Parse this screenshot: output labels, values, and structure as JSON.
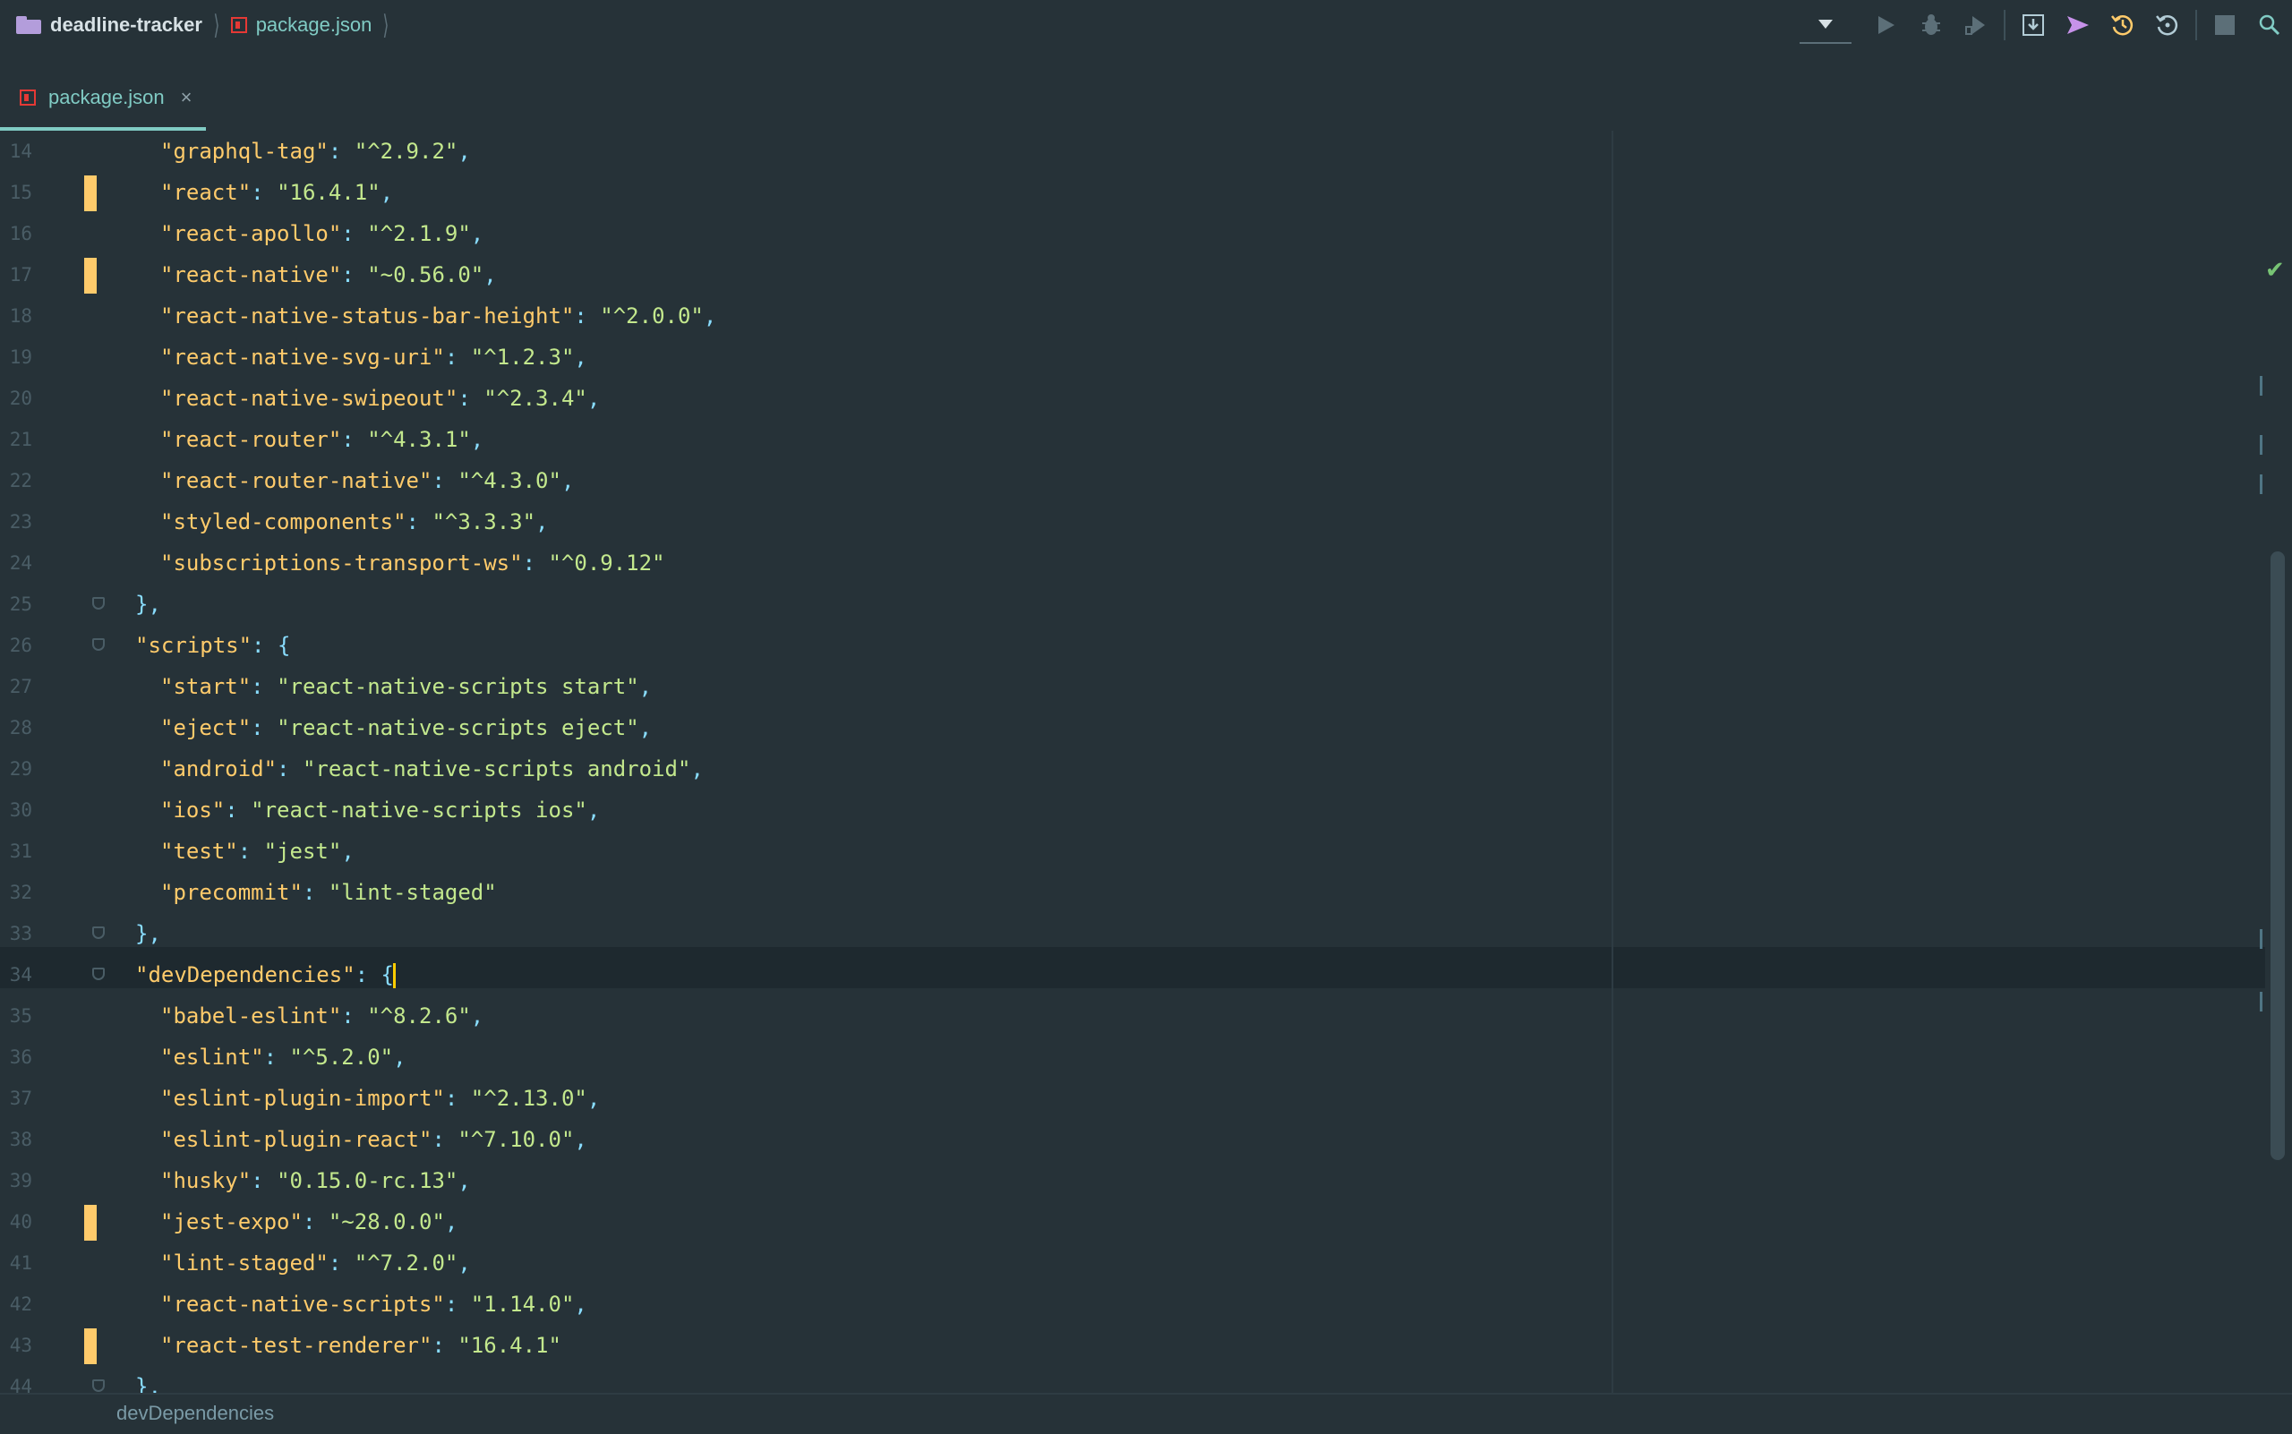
{
  "breadcrumb": {
    "project": "deadline-tracker",
    "file": "package.json"
  },
  "toolbar": {
    "icons": [
      "run-config-dropdown",
      "run-icon",
      "debug-icon",
      "run-coverage-icon",
      "vcs-update-icon",
      "vcs-push-icon",
      "vcs-history-icon",
      "rollback-icon",
      "stop-icon",
      "search-icon"
    ]
  },
  "tabs": [
    {
      "label": "package.json",
      "close": "×"
    }
  ],
  "editor": {
    "current_line": 34,
    "lines": [
      {
        "n": "14",
        "indent": 2,
        "key": "\"graphql-tag\"",
        "value": "\"^2.9.2\"",
        "trail": ","
      },
      {
        "n": "15",
        "indent": 2,
        "key": "\"react\"",
        "value": "\"16.4.1\"",
        "trail": ",",
        "marker": true
      },
      {
        "n": "16",
        "indent": 2,
        "key": "\"react-apollo\"",
        "value": "\"^2.1.9\"",
        "trail": ","
      },
      {
        "n": "17",
        "indent": 2,
        "key": "\"react-native\"",
        "value": "\"~0.56.0\"",
        "trail": ",",
        "marker": true
      },
      {
        "n": "18",
        "indent": 2,
        "key": "\"react-native-status-bar-height\"",
        "value": "\"^2.0.0\"",
        "trail": ","
      },
      {
        "n": "19",
        "indent": 2,
        "key": "\"react-native-svg-uri\"",
        "value": "\"^1.2.3\"",
        "trail": ","
      },
      {
        "n": "20",
        "indent": 2,
        "key": "\"react-native-swipeout\"",
        "value": "\"^2.3.4\"",
        "trail": ","
      },
      {
        "n": "21",
        "indent": 2,
        "key": "\"react-router\"",
        "value": "\"^4.3.1\"",
        "trail": ","
      },
      {
        "n": "22",
        "indent": 2,
        "key": "\"react-router-native\"",
        "value": "\"^4.3.0\"",
        "trail": ","
      },
      {
        "n": "23",
        "indent": 2,
        "key": "\"styled-components\"",
        "value": "\"^3.3.3\"",
        "trail": ","
      },
      {
        "n": "24",
        "indent": 2,
        "key": "\"subscriptions-transport-ws\"",
        "value": "\"^0.9.12\"",
        "trail": ""
      },
      {
        "n": "25",
        "indent": 1,
        "raw": "},",
        "fold": true
      },
      {
        "n": "26",
        "indent": 1,
        "key": "\"scripts\"",
        "value": "",
        "trail": "{",
        "fold": true
      },
      {
        "n": "27",
        "indent": 2,
        "key": "\"start\"",
        "value": "\"react-native-scripts start\"",
        "trail": ","
      },
      {
        "n": "28",
        "indent": 2,
        "key": "\"eject\"",
        "value": "\"react-native-scripts eject\"",
        "trail": ","
      },
      {
        "n": "29",
        "indent": 2,
        "key": "\"android\"",
        "value": "\"react-native-scripts android\"",
        "trail": ","
      },
      {
        "n": "30",
        "indent": 2,
        "key": "\"ios\"",
        "value": "\"react-native-scripts ios\"",
        "trail": ","
      },
      {
        "n": "31",
        "indent": 2,
        "key": "\"test\"",
        "value": "\"jest\"",
        "trail": ","
      },
      {
        "n": "32",
        "indent": 2,
        "key": "\"precommit\"",
        "value": "\"lint-staged\"",
        "trail": ""
      },
      {
        "n": "33",
        "indent": 1,
        "raw": "},",
        "fold": true
      },
      {
        "n": "34",
        "indent": 1,
        "key": "\"devDependencies\"",
        "value": "",
        "trail": "{",
        "fold": true,
        "caret": true
      },
      {
        "n": "35",
        "indent": 2,
        "key": "\"babel-eslint\"",
        "value": "\"^8.2.6\"",
        "trail": ","
      },
      {
        "n": "36",
        "indent": 2,
        "key": "\"eslint\"",
        "value": "\"^5.2.0\"",
        "trail": ","
      },
      {
        "n": "37",
        "indent": 2,
        "key": "\"eslint-plugin-import\"",
        "value": "\"^2.13.0\"",
        "trail": ","
      },
      {
        "n": "38",
        "indent": 2,
        "key": "\"eslint-plugin-react\"",
        "value": "\"^7.10.0\"",
        "trail": ","
      },
      {
        "n": "39",
        "indent": 2,
        "key": "\"husky\"",
        "value": "\"0.15.0-rc.13\"",
        "trail": ","
      },
      {
        "n": "40",
        "indent": 2,
        "key": "\"jest-expo\"",
        "value": "\"~28.0.0\"",
        "trail": ",",
        "marker": true
      },
      {
        "n": "41",
        "indent": 2,
        "key": "\"lint-staged\"",
        "value": "\"^7.2.0\"",
        "trail": ","
      },
      {
        "n": "42",
        "indent": 2,
        "key": "\"react-native-scripts\"",
        "value": "\"1.14.0\"",
        "trail": ","
      },
      {
        "n": "43",
        "indent": 2,
        "key": "\"react-test-renderer\"",
        "value": "\"16.4.1\"",
        "trail": "",
        "marker": true
      },
      {
        "n": "44",
        "indent": 1,
        "raw": "},",
        "fold": true
      }
    ]
  },
  "statusbar": {
    "breadcrumb": "devDependencies"
  },
  "colors": {
    "background": "#263238",
    "key": "#ffcb6b",
    "string": "#c3e88d",
    "punctuation": "#89ddff",
    "accent": "#80cbc4",
    "change_marker": "#ffcb6b"
  }
}
